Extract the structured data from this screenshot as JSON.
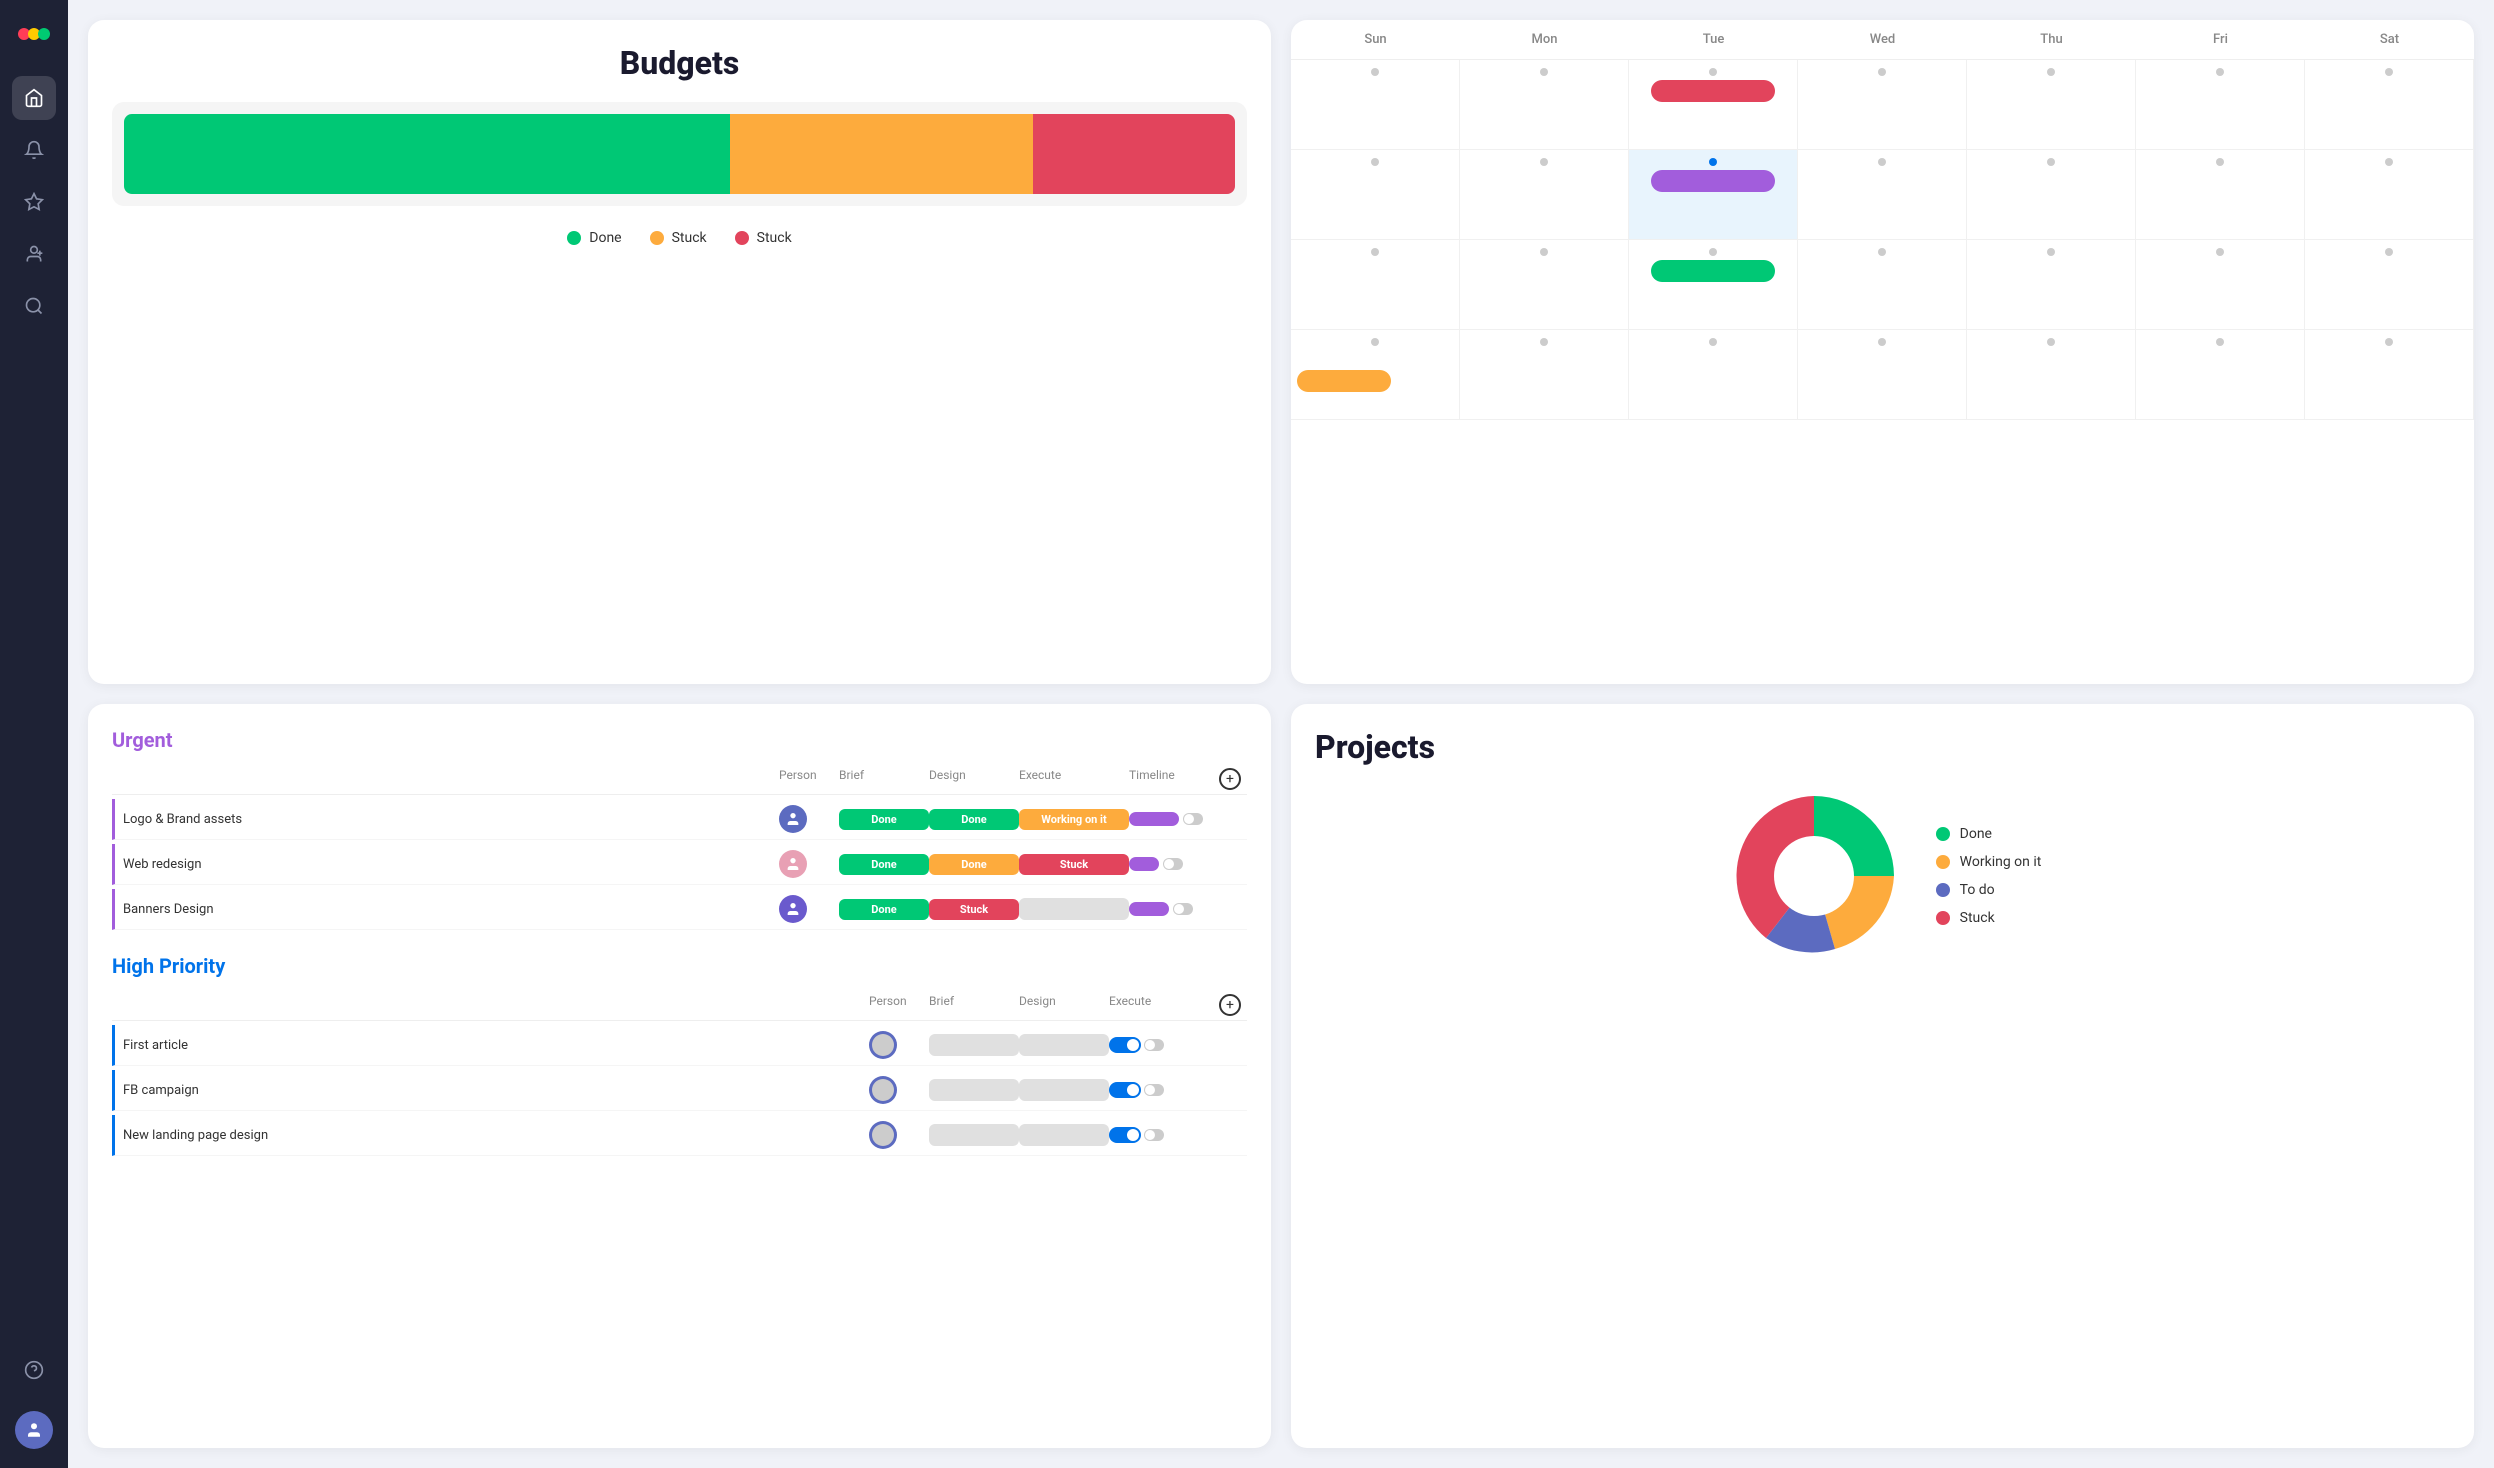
{
  "sidebar": {
    "logo_label": "Monday Logo",
    "nav_items": [
      {
        "id": "home",
        "icon": "🏠",
        "label": "Home",
        "active": true
      },
      {
        "id": "bell",
        "icon": "🔔",
        "label": "Notifications",
        "active": false
      },
      {
        "id": "star",
        "icon": "⭐",
        "label": "Favorites",
        "active": false
      },
      {
        "id": "user-plus",
        "icon": "👤",
        "label": "Invite",
        "active": false
      },
      {
        "id": "search",
        "icon": "🔍",
        "label": "Search",
        "active": false
      },
      {
        "id": "help",
        "icon": "❓",
        "label": "Help",
        "active": false
      }
    ]
  },
  "budgets": {
    "title": "Budgets",
    "legend": [
      {
        "label": "Done",
        "color": "#00c875"
      },
      {
        "label": "Stuck",
        "color": "#fdab3d"
      },
      {
        "label": "Stuck",
        "color": "#e2445c"
      }
    ],
    "bar_segments": [
      {
        "color": "#00c875",
        "flex": 3
      },
      {
        "color": "#fdab3d",
        "flex": 1.5
      },
      {
        "color": "#e2445c",
        "flex": 1
      }
    ]
  },
  "calendar": {
    "days": [
      "Sun",
      "Mon",
      "Tue",
      "Wed",
      "Thu",
      "Fri",
      "Sat"
    ]
  },
  "urgent": {
    "title": "Urgent",
    "columns": [
      "Person",
      "Brief",
      "Design",
      "Execute",
      "Timeline",
      ""
    ],
    "rows": [
      {
        "name": "Logo & Brand assets",
        "brief": "Done",
        "design": "Done",
        "execute": "Working on it",
        "has_timeline": true
      },
      {
        "name": "Web redesign",
        "brief": "Done",
        "design": "Done",
        "execute": "Stuck",
        "has_timeline": true
      },
      {
        "name": "Banners Design",
        "brief": "Done",
        "design": "Stuck",
        "execute": "",
        "has_timeline": true
      }
    ]
  },
  "high_priority": {
    "title": "High Priority",
    "columns": [
      "Person",
      "Brief",
      "Design",
      "Execute",
      ""
    ],
    "rows": [
      {
        "name": "First article"
      },
      {
        "name": "FB campaign"
      },
      {
        "name": "New landing page design"
      }
    ]
  },
  "projects": {
    "title": "Projects",
    "legend": [
      {
        "label": "Done",
        "color": "#00c875"
      },
      {
        "label": "Working on it",
        "color": "#fdab3d"
      },
      {
        "label": "To do",
        "color": "#5c6bc0"
      },
      {
        "label": "Stuck",
        "color": "#e2445c"
      }
    ]
  }
}
